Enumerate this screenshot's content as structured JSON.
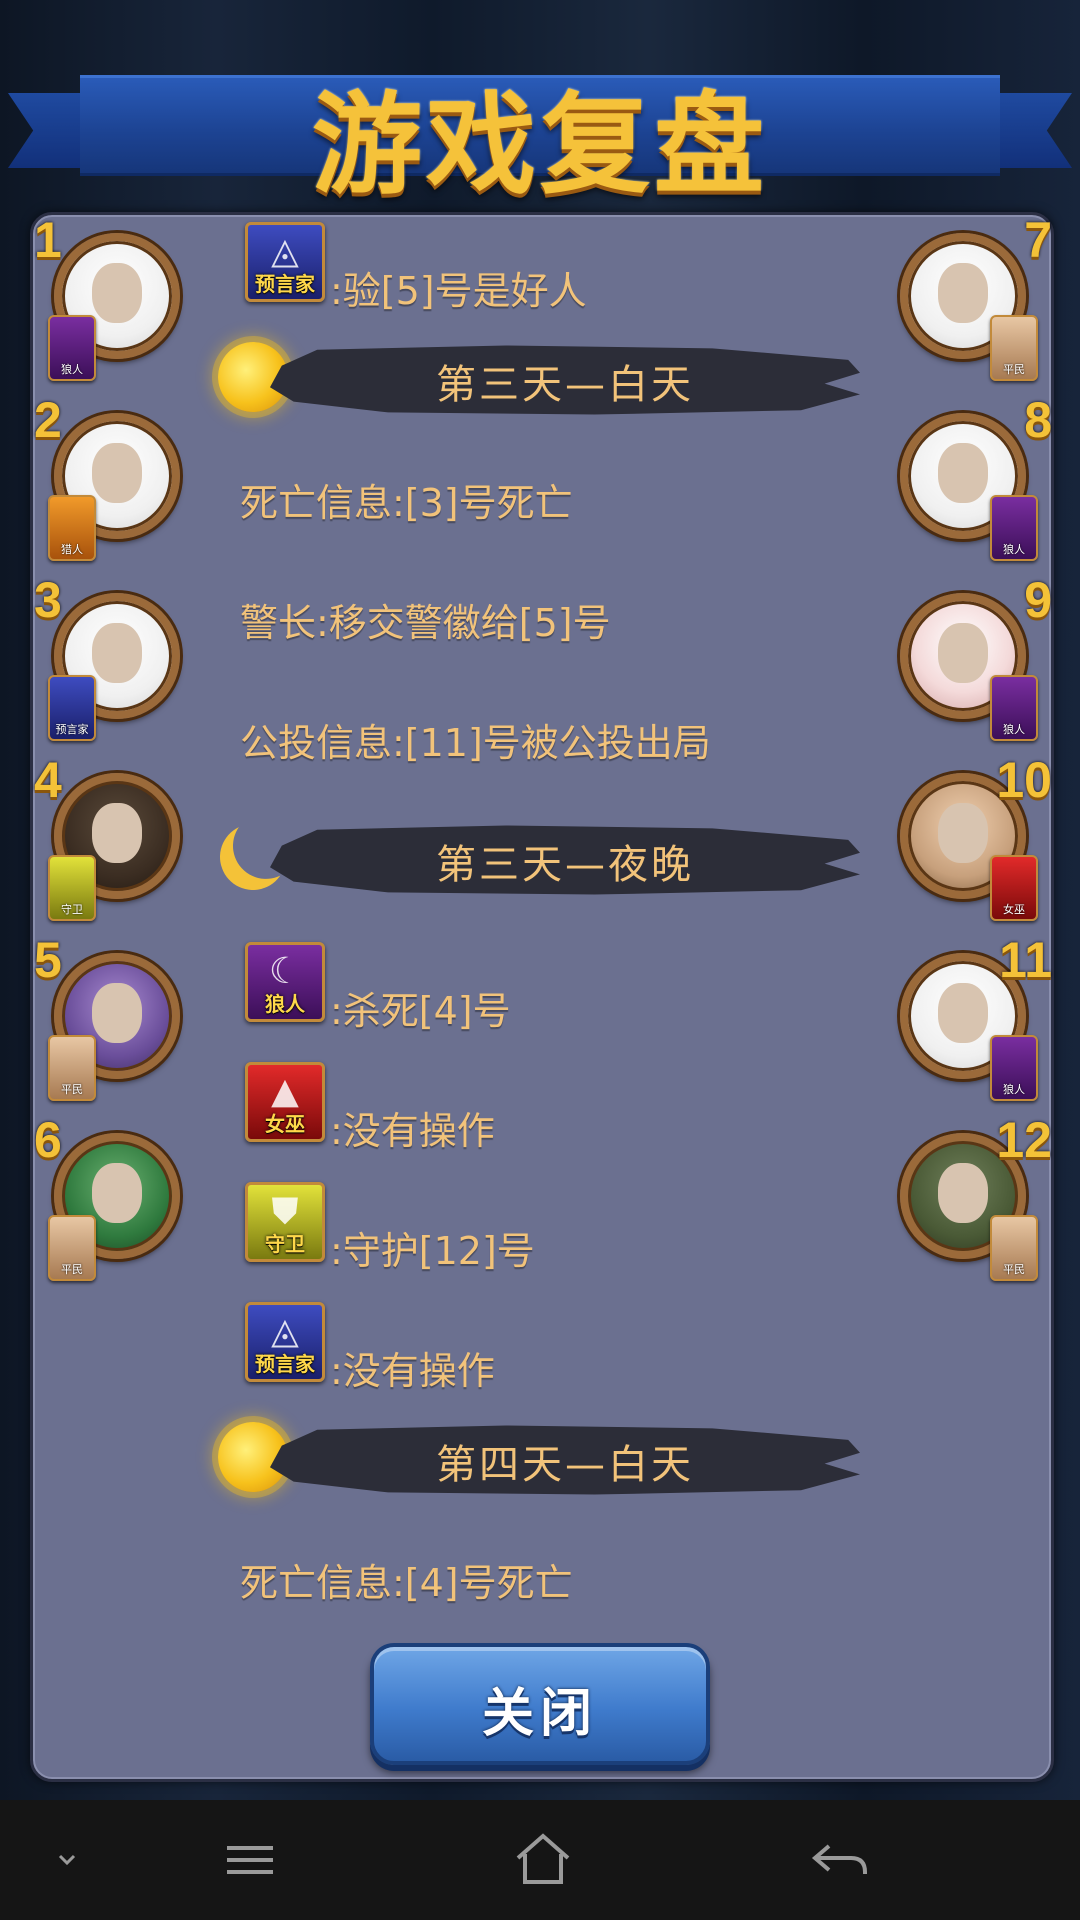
{
  "title": "游戏复盘",
  "players_left": [
    {
      "num": "1",
      "role": "狼人",
      "role_class": "r-wolf",
      "avatar": "white"
    },
    {
      "num": "2",
      "role": "猎人",
      "role_class": "r-hunter",
      "avatar": "white"
    },
    {
      "num": "3",
      "role": "预言家",
      "role_class": "r-seer",
      "avatar": "white"
    },
    {
      "num": "4",
      "role": "守卫",
      "role_class": "r-guard",
      "avatar": "dark2"
    },
    {
      "num": "5",
      "role": "平民",
      "role_class": "r-civ",
      "avatar": "purple"
    },
    {
      "num": "6",
      "role": "平民",
      "role_class": "r-civ",
      "avatar": "green"
    }
  ],
  "players_right": [
    {
      "num": "7",
      "role": "平民",
      "role_class": "r-civ",
      "avatar": "white"
    },
    {
      "num": "8",
      "role": "狼人",
      "role_class": "r-wolf",
      "avatar": "white"
    },
    {
      "num": "9",
      "role": "狼人",
      "role_class": "r-wolf",
      "avatar": "pink"
    },
    {
      "num": "10",
      "role": "女巫",
      "role_class": "r-witch",
      "avatar": "baby"
    },
    {
      "num": "11",
      "role": "狼人",
      "role_class": "r-wolf",
      "avatar": "white"
    },
    {
      "num": "12",
      "role": "平民",
      "role_class": "r-civ",
      "avatar": "dark"
    }
  ],
  "log": {
    "seer_check": {
      "role": "预言家",
      "text": ":验[5]号是好人"
    },
    "day3_header": "第三天—白天",
    "death_info_1": "死亡信息:[3]号死亡",
    "sheriff": "警长:移交警徽给[5]号",
    "vote_info": "公投信息:[11]号被公投出局",
    "night3_header": "第三天—夜晚",
    "wolf_action": {
      "role": "狼人",
      "text": ":杀死[4]号"
    },
    "witch_action": {
      "role": "女巫",
      "text": ":没有操作"
    },
    "guard_action": {
      "role": "守卫",
      "text": ":守护[12]号"
    },
    "seer_action": {
      "role": "预言家",
      "text": ":没有操作"
    },
    "day4_header": "第四天—白天",
    "death_info_2": "死亡信息:[4]号死亡"
  },
  "close_button": "关闭",
  "colors": {
    "panel": "#6b7090",
    "text_gold": "#f2c37a",
    "number_gold": "#f4c238",
    "button_blue": "#3f7bcc"
  }
}
